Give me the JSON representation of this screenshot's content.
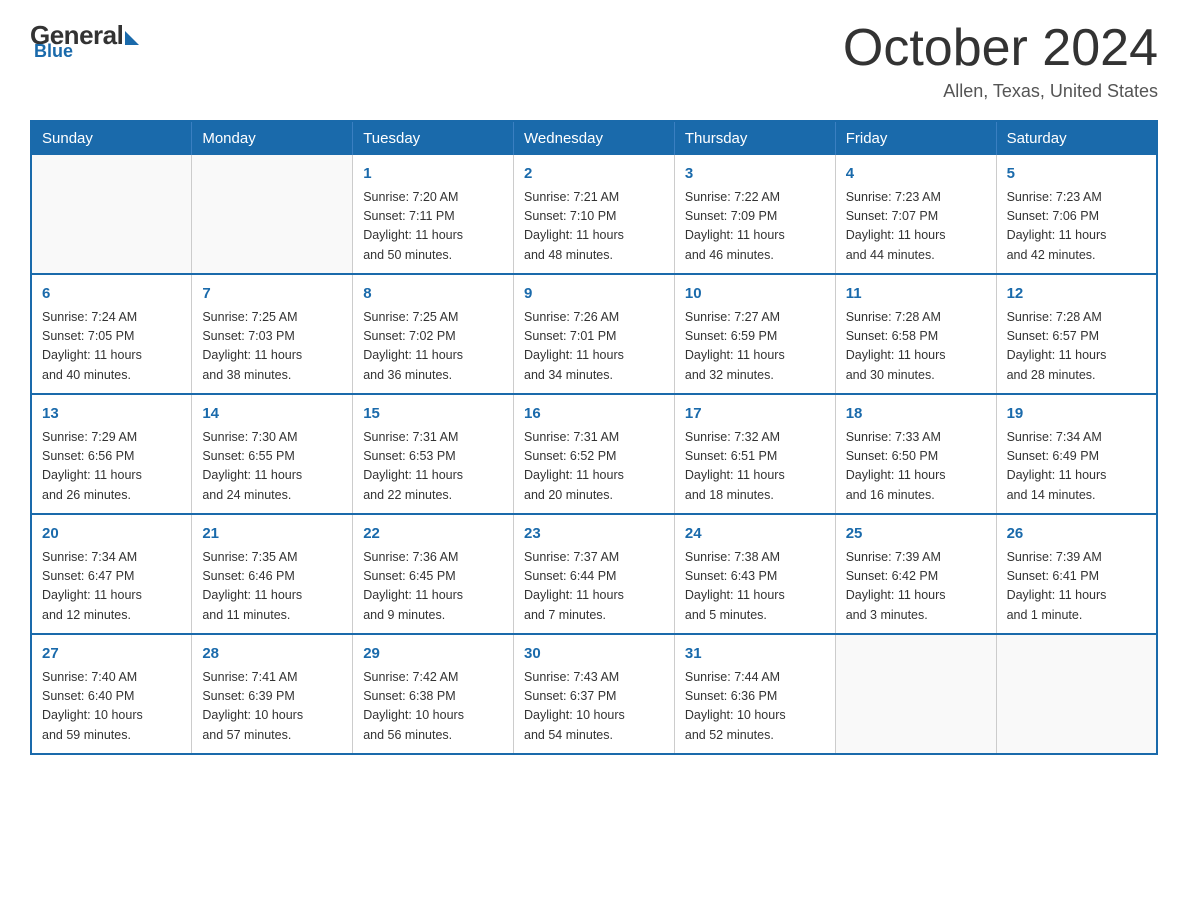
{
  "header": {
    "logo": {
      "general_text": "General",
      "blue_text": "Blue"
    },
    "title": "October 2024",
    "location": "Allen, Texas, United States"
  },
  "weekdays": [
    "Sunday",
    "Monday",
    "Tuesday",
    "Wednesday",
    "Thursday",
    "Friday",
    "Saturday"
  ],
  "weeks": [
    [
      {
        "day": "",
        "info": ""
      },
      {
        "day": "",
        "info": ""
      },
      {
        "day": "1",
        "info": "Sunrise: 7:20 AM\nSunset: 7:11 PM\nDaylight: 11 hours\nand 50 minutes."
      },
      {
        "day": "2",
        "info": "Sunrise: 7:21 AM\nSunset: 7:10 PM\nDaylight: 11 hours\nand 48 minutes."
      },
      {
        "day": "3",
        "info": "Sunrise: 7:22 AM\nSunset: 7:09 PM\nDaylight: 11 hours\nand 46 minutes."
      },
      {
        "day": "4",
        "info": "Sunrise: 7:23 AM\nSunset: 7:07 PM\nDaylight: 11 hours\nand 44 minutes."
      },
      {
        "day": "5",
        "info": "Sunrise: 7:23 AM\nSunset: 7:06 PM\nDaylight: 11 hours\nand 42 minutes."
      }
    ],
    [
      {
        "day": "6",
        "info": "Sunrise: 7:24 AM\nSunset: 7:05 PM\nDaylight: 11 hours\nand 40 minutes."
      },
      {
        "day": "7",
        "info": "Sunrise: 7:25 AM\nSunset: 7:03 PM\nDaylight: 11 hours\nand 38 minutes."
      },
      {
        "day": "8",
        "info": "Sunrise: 7:25 AM\nSunset: 7:02 PM\nDaylight: 11 hours\nand 36 minutes."
      },
      {
        "day": "9",
        "info": "Sunrise: 7:26 AM\nSunset: 7:01 PM\nDaylight: 11 hours\nand 34 minutes."
      },
      {
        "day": "10",
        "info": "Sunrise: 7:27 AM\nSunset: 6:59 PM\nDaylight: 11 hours\nand 32 minutes."
      },
      {
        "day": "11",
        "info": "Sunrise: 7:28 AM\nSunset: 6:58 PM\nDaylight: 11 hours\nand 30 minutes."
      },
      {
        "day": "12",
        "info": "Sunrise: 7:28 AM\nSunset: 6:57 PM\nDaylight: 11 hours\nand 28 minutes."
      }
    ],
    [
      {
        "day": "13",
        "info": "Sunrise: 7:29 AM\nSunset: 6:56 PM\nDaylight: 11 hours\nand 26 minutes."
      },
      {
        "day": "14",
        "info": "Sunrise: 7:30 AM\nSunset: 6:55 PM\nDaylight: 11 hours\nand 24 minutes."
      },
      {
        "day": "15",
        "info": "Sunrise: 7:31 AM\nSunset: 6:53 PM\nDaylight: 11 hours\nand 22 minutes."
      },
      {
        "day": "16",
        "info": "Sunrise: 7:31 AM\nSunset: 6:52 PM\nDaylight: 11 hours\nand 20 minutes."
      },
      {
        "day": "17",
        "info": "Sunrise: 7:32 AM\nSunset: 6:51 PM\nDaylight: 11 hours\nand 18 minutes."
      },
      {
        "day": "18",
        "info": "Sunrise: 7:33 AM\nSunset: 6:50 PM\nDaylight: 11 hours\nand 16 minutes."
      },
      {
        "day": "19",
        "info": "Sunrise: 7:34 AM\nSunset: 6:49 PM\nDaylight: 11 hours\nand 14 minutes."
      }
    ],
    [
      {
        "day": "20",
        "info": "Sunrise: 7:34 AM\nSunset: 6:47 PM\nDaylight: 11 hours\nand 12 minutes."
      },
      {
        "day": "21",
        "info": "Sunrise: 7:35 AM\nSunset: 6:46 PM\nDaylight: 11 hours\nand 11 minutes."
      },
      {
        "day": "22",
        "info": "Sunrise: 7:36 AM\nSunset: 6:45 PM\nDaylight: 11 hours\nand 9 minutes."
      },
      {
        "day": "23",
        "info": "Sunrise: 7:37 AM\nSunset: 6:44 PM\nDaylight: 11 hours\nand 7 minutes."
      },
      {
        "day": "24",
        "info": "Sunrise: 7:38 AM\nSunset: 6:43 PM\nDaylight: 11 hours\nand 5 minutes."
      },
      {
        "day": "25",
        "info": "Sunrise: 7:39 AM\nSunset: 6:42 PM\nDaylight: 11 hours\nand 3 minutes."
      },
      {
        "day": "26",
        "info": "Sunrise: 7:39 AM\nSunset: 6:41 PM\nDaylight: 11 hours\nand 1 minute."
      }
    ],
    [
      {
        "day": "27",
        "info": "Sunrise: 7:40 AM\nSunset: 6:40 PM\nDaylight: 10 hours\nand 59 minutes."
      },
      {
        "day": "28",
        "info": "Sunrise: 7:41 AM\nSunset: 6:39 PM\nDaylight: 10 hours\nand 57 minutes."
      },
      {
        "day": "29",
        "info": "Sunrise: 7:42 AM\nSunset: 6:38 PM\nDaylight: 10 hours\nand 56 minutes."
      },
      {
        "day": "30",
        "info": "Sunrise: 7:43 AM\nSunset: 6:37 PM\nDaylight: 10 hours\nand 54 minutes."
      },
      {
        "day": "31",
        "info": "Sunrise: 7:44 AM\nSunset: 6:36 PM\nDaylight: 10 hours\nand 52 minutes."
      },
      {
        "day": "",
        "info": ""
      },
      {
        "day": "",
        "info": ""
      }
    ]
  ]
}
